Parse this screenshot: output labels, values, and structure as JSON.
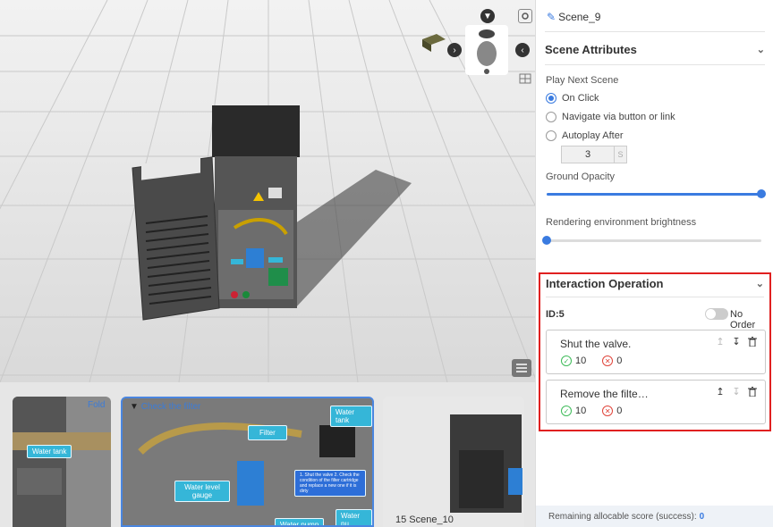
{
  "viewport": {
    "icons": [
      "chevron-down-icon",
      "snapshot-icon",
      "chevron-left-icon",
      "chevron-right-icon",
      "grid-icon",
      "list-icon"
    ]
  },
  "thumbnails": [
    {
      "title": "Fold",
      "footer": "",
      "labels": [
        "Water tank"
      ]
    },
    {
      "title": "Check the filter",
      "footer": "",
      "labels": [
        "Water tank",
        "Filter",
        "Water level gauge",
        "Water pump",
        "Water pu",
        "1. Shut the valve 2. Check the condition of the filter cartridge and replace a new one if it is dirty"
      ]
    },
    {
      "title": "",
      "footer": "15   Scene_10",
      "labels": []
    }
  ],
  "panel": {
    "scene_name": "Scene_9",
    "scene_attributes": {
      "title": "Scene Attributes",
      "play_next_label": "Play Next Scene",
      "options": [
        "On Click",
        "Navigate via button or link",
        "Autoplay After"
      ],
      "selected": "On Click",
      "autoplay_seconds": "3",
      "autoplay_unit": "S",
      "ground_opacity_label": "Ground Opacity",
      "ground_opacity": 1.0,
      "brightness_label": "Rendering environment brightness",
      "brightness": 0.0
    },
    "interaction": {
      "title": "Interaction Operation",
      "id_label": "ID:5",
      "order_label": "No Order",
      "order_enabled": false,
      "operations": [
        {
          "title": "Shut the valve.",
          "success": "10",
          "fail": "0"
        },
        {
          "title": "Remove the filte…",
          "success": "10",
          "fail": "0"
        }
      ]
    },
    "footer": {
      "label": "Remaining allocable score (success):",
      "score": "0"
    }
  },
  "colors": {
    "accent": "#3a7be0",
    "highlight_border": "#e02020",
    "success": "#3dbb58",
    "fail": "#e0443a",
    "tag": "#35b6d8"
  }
}
